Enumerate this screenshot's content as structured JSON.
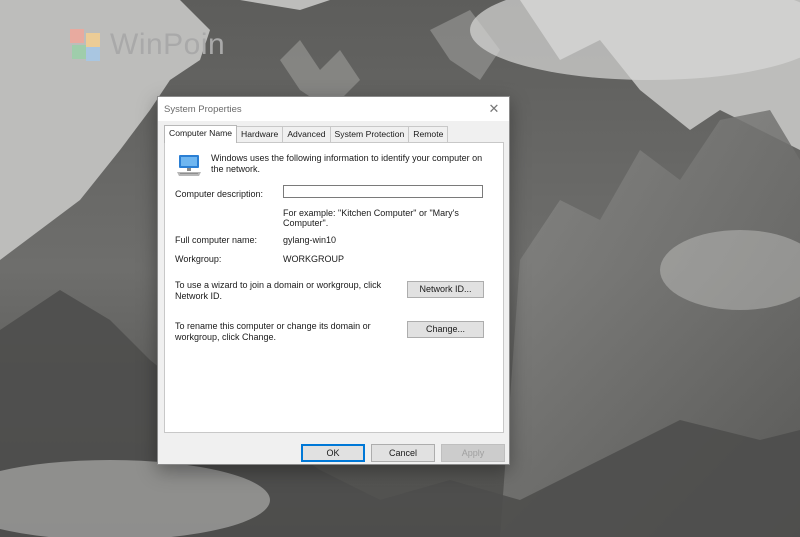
{
  "watermark": {
    "brand": "WinPoin"
  },
  "dialog": {
    "title": "System Properties",
    "close_glyph": "✕",
    "tabs": [
      {
        "label": "Computer Name",
        "active": true
      },
      {
        "label": "Hardware"
      },
      {
        "label": "Advanced"
      },
      {
        "label": "System Protection"
      },
      {
        "label": "Remote"
      }
    ],
    "intro_text": "Windows uses the following information to identify your computer on the network.",
    "computer_description": {
      "label": "Computer description:",
      "value": ""
    },
    "example_text": "For example: \"Kitchen Computer\" or \"Mary's Computer\".",
    "full_name": {
      "label": "Full computer name:",
      "value": "gylang-win10"
    },
    "workgroup": {
      "label": "Workgroup:",
      "value": "WORKGROUP"
    },
    "network_id": {
      "text": "To use a wizard to join a domain or workgroup, click Network ID.",
      "button_label": "Network ID..."
    },
    "change": {
      "text": "To rename this computer or change its domain or workgroup, click Change.",
      "button_label": "Change..."
    },
    "footer": {
      "ok_label": "OK",
      "cancel_label": "Cancel",
      "apply_label": "Apply"
    }
  },
  "colors": {
    "accent": "#0078d7",
    "dialog_bg": "#f0f0f0",
    "panel_bg": "#ffffff"
  }
}
